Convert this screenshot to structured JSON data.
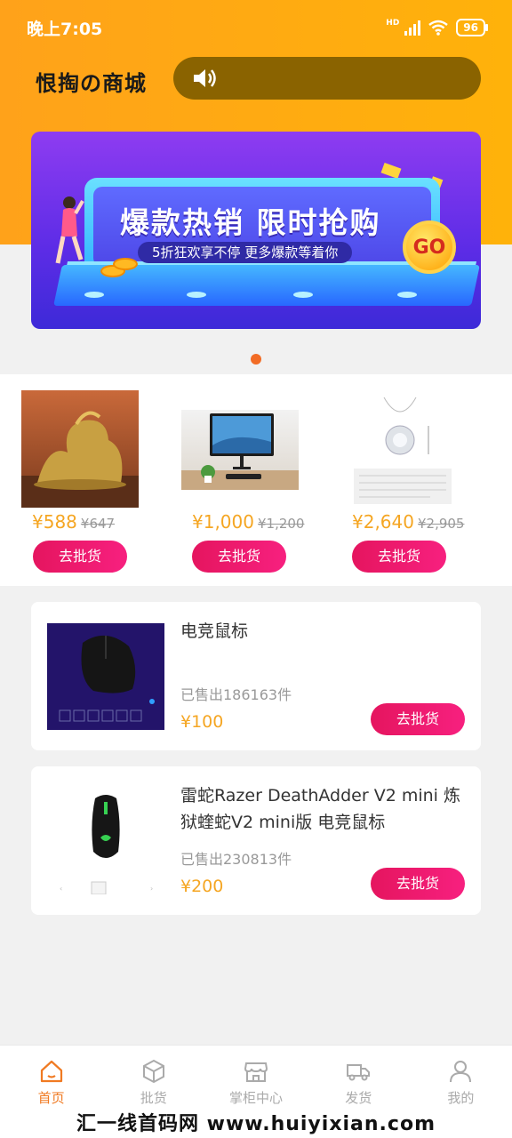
{
  "status_bar": {
    "time": "晚上7:05",
    "battery": "96",
    "network": "HD"
  },
  "header": {
    "logo_text": "恨掏の商城"
  },
  "banner": {
    "title": "爆款热销 限时抢购",
    "subtitle": "5折狂欢享不停 更多爆款等着你",
    "go_label": "GO",
    "dot_count": 1,
    "active_dot": 0
  },
  "featured_products": [
    {
      "image": "dragon-statue",
      "price": "¥588",
      "original_price": "¥647",
      "button_label": "去批货"
    },
    {
      "image": "monitor",
      "price": "¥1,000",
      "original_price": "¥1,200",
      "button_label": "去批货"
    },
    {
      "image": "diamond-pendant",
      "price": "¥2,640",
      "original_price": "¥2,905",
      "button_label": "去批货"
    }
  ],
  "product_list": [
    {
      "image": "gaming-mouse-dark",
      "title": "电竞鼠标",
      "sold": "已售出186163件",
      "price": "¥100",
      "button_label": "去批货"
    },
    {
      "image": "razer-mouse",
      "title": "雷蛇Razer DeathAdder V2 mini 炼狱蝰蛇V2 mini版 电竞鼠标",
      "sold": "已售出230813件",
      "price": "¥200",
      "button_label": "去批货"
    }
  ],
  "bottom_nav": {
    "items": [
      {
        "label": "首页",
        "icon": "home-icon",
        "active": true
      },
      {
        "label": "批货",
        "icon": "box-icon",
        "active": false
      },
      {
        "label": "掌柜中心",
        "icon": "store-icon",
        "active": false
      },
      {
        "label": "发货",
        "icon": "truck-icon",
        "active": false
      },
      {
        "label": "我的",
        "icon": "user-icon",
        "active": false
      }
    ]
  },
  "watermark": "汇一线首码网 www.huiyixian.com",
  "colors": {
    "accent": "#f5a623",
    "button": "#ee1a6d",
    "header_bg": "#ffa91a",
    "active_nav": "#f07a22"
  }
}
